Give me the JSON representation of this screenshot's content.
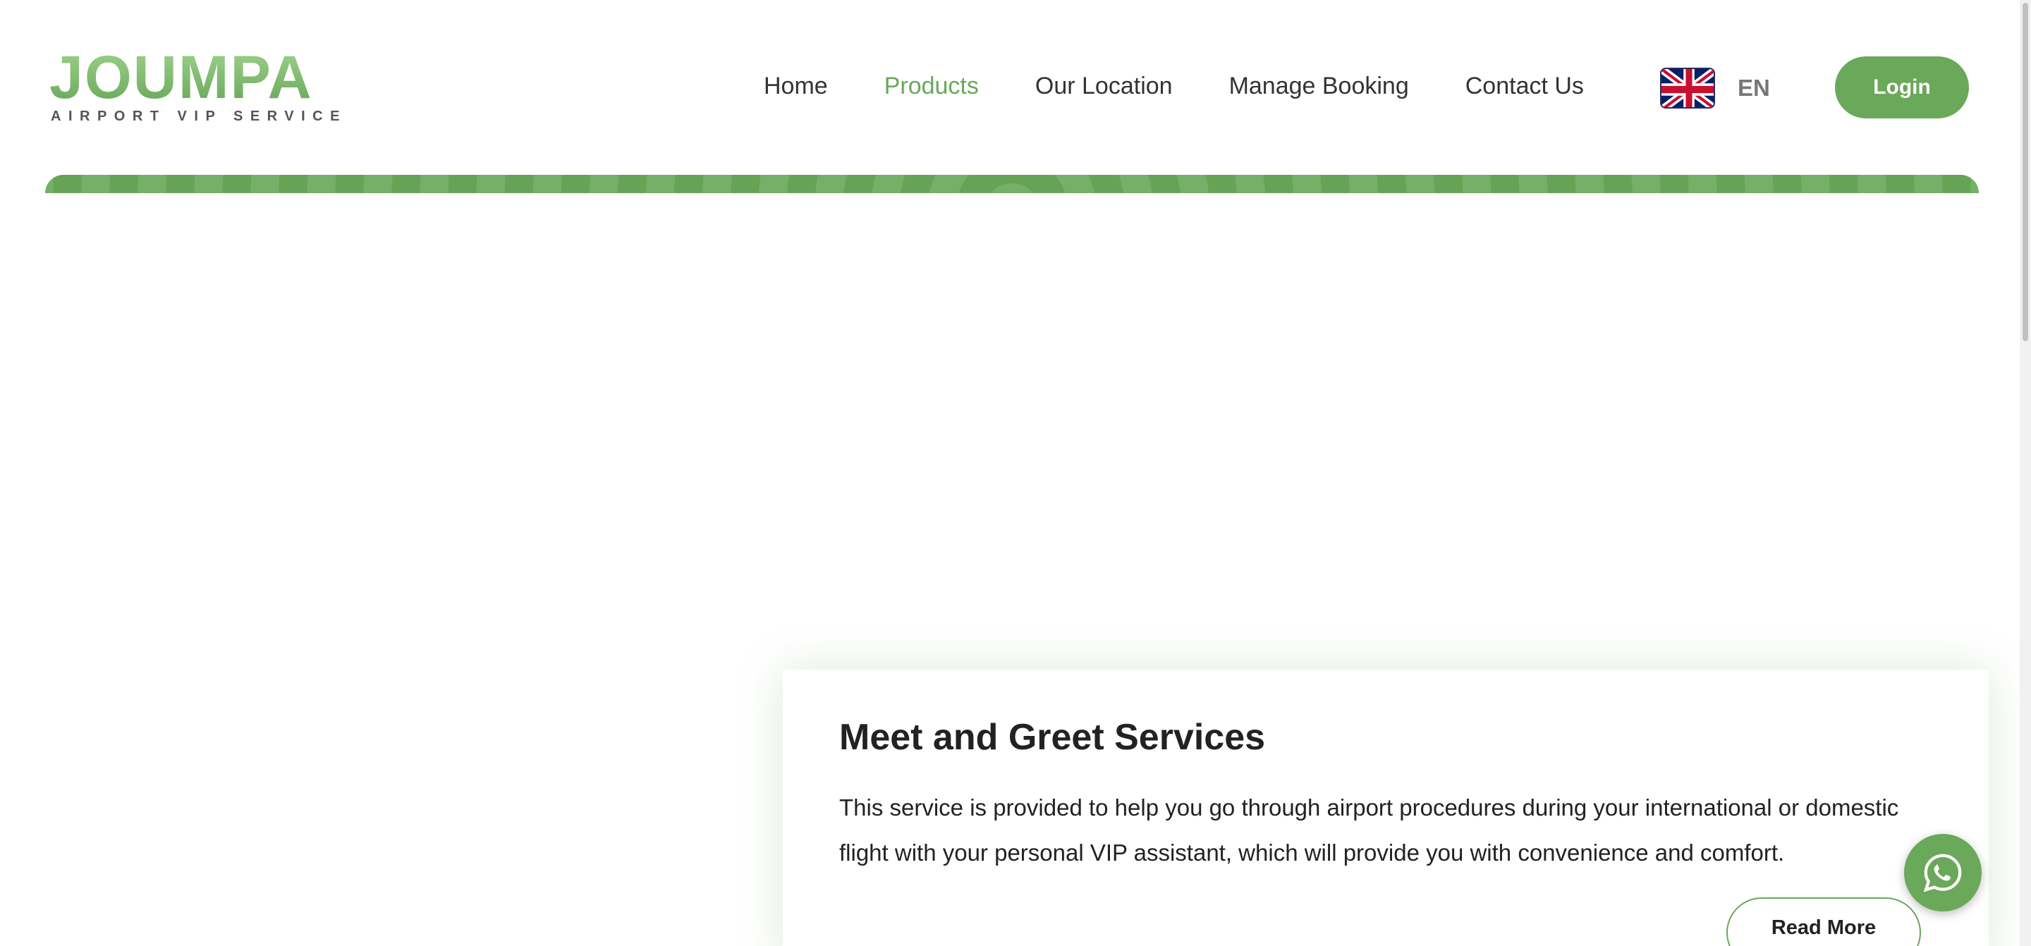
{
  "brand": {
    "name": "JOUMPA",
    "tagline": "AIRPORT VIP SERVICE"
  },
  "nav": {
    "items": [
      {
        "label": "Home",
        "active": false
      },
      {
        "label": "Products",
        "active": true
      },
      {
        "label": "Our Location",
        "active": false
      },
      {
        "label": "Manage Booking",
        "active": false
      },
      {
        "label": "Contact Us",
        "active": false
      }
    ]
  },
  "language": {
    "code": "EN",
    "flag_icon": "uk-flag-icon"
  },
  "login": {
    "label": "Login"
  },
  "card": {
    "title": "Meet and Greet Services",
    "description": "This service is provided to help you go through airport procedures during your international or domestic flight with your personal VIP assistant, which will provide you with convenience and comfort.",
    "read_more_label": "Read More"
  },
  "floating": {
    "whatsapp_icon": "whatsapp-icon"
  },
  "colors": {
    "brand_green": "#6aa85a",
    "text_dark": "#222222"
  }
}
